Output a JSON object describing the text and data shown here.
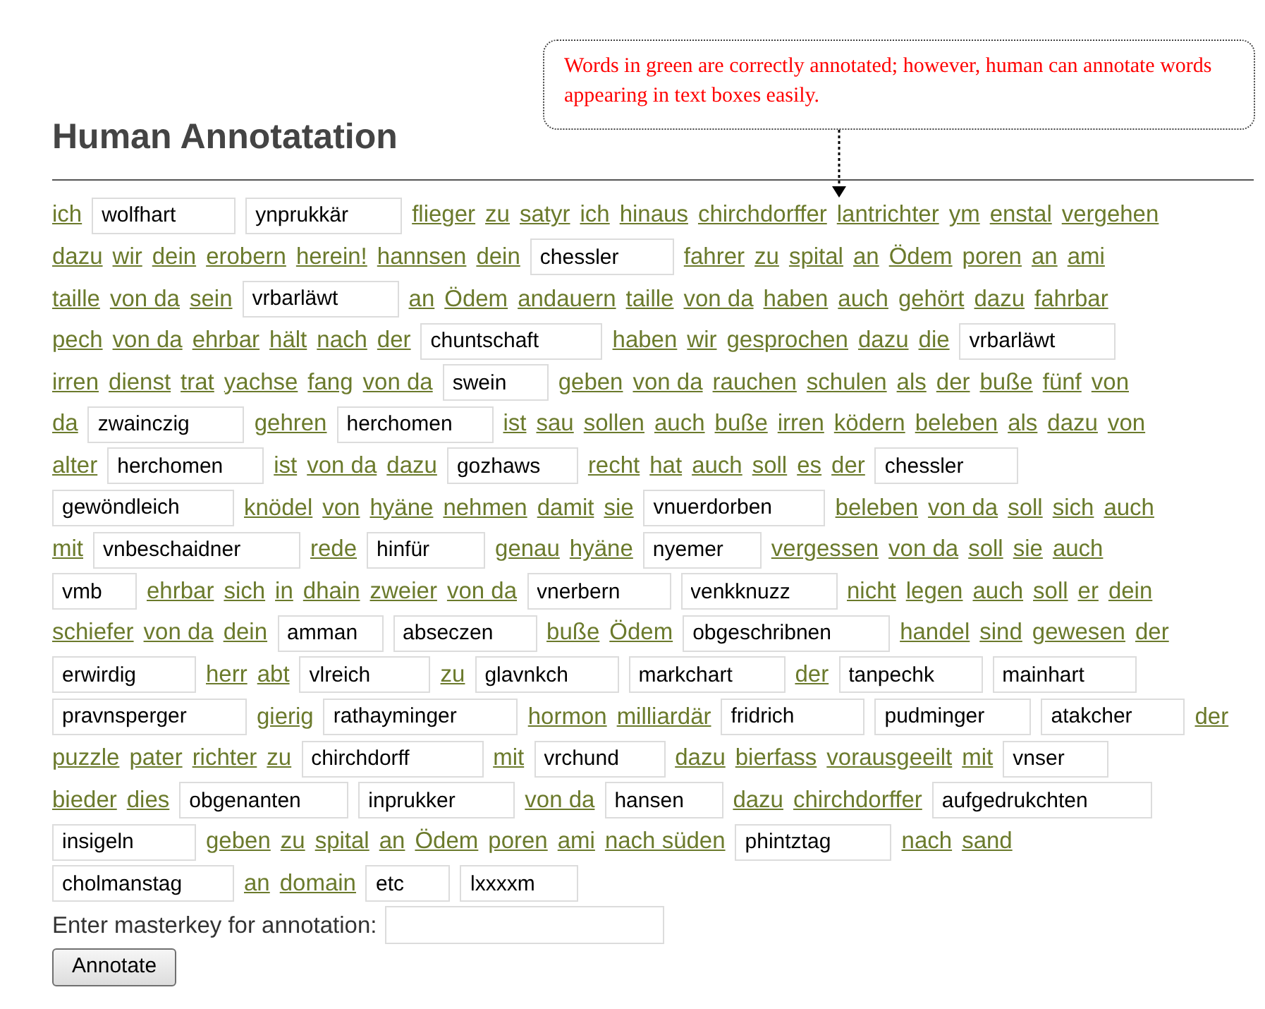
{
  "callout": {
    "text": "Words in green are correctly annotated; however, human can annotate words appearing in text boxes easily."
  },
  "heading": "Human Annotatation",
  "lines": [
    [
      {
        "kind": "word",
        "text": "ich"
      },
      {
        "kind": "field",
        "text": "wolfhart"
      },
      {
        "kind": "field",
        "text": "ynprukkär"
      },
      {
        "kind": "word",
        "text": "flieger"
      },
      {
        "kind": "word",
        "text": "zu"
      },
      {
        "kind": "word",
        "text": "satyr"
      },
      {
        "kind": "word",
        "text": "ich"
      },
      {
        "kind": "word",
        "text": "hinaus"
      },
      {
        "kind": "word",
        "text": "chirchdorffer"
      },
      {
        "kind": "word",
        "text": "lantrichter"
      },
      {
        "kind": "word",
        "text": "ym"
      },
      {
        "kind": "word",
        "text": "enstal"
      },
      {
        "kind": "word",
        "text": "vergehen"
      }
    ],
    [
      {
        "kind": "word",
        "text": "dazu"
      },
      {
        "kind": "word",
        "text": "wir"
      },
      {
        "kind": "word",
        "text": "dein"
      },
      {
        "kind": "word",
        "text": "erobern"
      },
      {
        "kind": "word",
        "text": "herein!"
      },
      {
        "kind": "word",
        "text": "hannsen"
      },
      {
        "kind": "word",
        "text": "dein"
      },
      {
        "kind": "field",
        "text": "chessler"
      },
      {
        "kind": "word",
        "text": "fahrer"
      },
      {
        "kind": "word",
        "text": "zu"
      },
      {
        "kind": "word",
        "text": "spital"
      },
      {
        "kind": "word",
        "text": "an"
      },
      {
        "kind": "word",
        "text": "Ödem"
      },
      {
        "kind": "word",
        "text": "poren"
      },
      {
        "kind": "word",
        "text": "an"
      },
      {
        "kind": "word",
        "text": "ami"
      }
    ],
    [
      {
        "kind": "word",
        "text": "taille"
      },
      {
        "kind": "word",
        "text": "von da"
      },
      {
        "kind": "word",
        "text": "sein"
      },
      {
        "kind": "field",
        "text": "vrbarläwt"
      },
      {
        "kind": "word",
        "text": "an"
      },
      {
        "kind": "word",
        "text": "Ödem"
      },
      {
        "kind": "word",
        "text": "andauern"
      },
      {
        "kind": "word",
        "text": "taille"
      },
      {
        "kind": "word",
        "text": "von da"
      },
      {
        "kind": "word",
        "text": "haben"
      },
      {
        "kind": "word",
        "text": "auch"
      },
      {
        "kind": "word",
        "text": "gehört"
      },
      {
        "kind": "word",
        "text": "dazu"
      },
      {
        "kind": "word",
        "text": "fahrbar"
      }
    ],
    [
      {
        "kind": "word",
        "text": "pech"
      },
      {
        "kind": "word",
        "text": "von da"
      },
      {
        "kind": "word",
        "text": "ehrbar"
      },
      {
        "kind": "word",
        "text": "hält"
      },
      {
        "kind": "word",
        "text": "nach"
      },
      {
        "kind": "word",
        "text": "der"
      },
      {
        "kind": "field",
        "text": "chuntschaft"
      },
      {
        "kind": "word",
        "text": "haben"
      },
      {
        "kind": "word",
        "text": "wir"
      },
      {
        "kind": "word",
        "text": "gesprochen"
      },
      {
        "kind": "word",
        "text": "dazu"
      },
      {
        "kind": "word",
        "text": "die"
      },
      {
        "kind": "field",
        "text": "vrbarläwt"
      }
    ],
    [
      {
        "kind": "word",
        "text": "irren"
      },
      {
        "kind": "word",
        "text": "dienst"
      },
      {
        "kind": "word",
        "text": "trat"
      },
      {
        "kind": "word",
        "text": "yachse"
      },
      {
        "kind": "word",
        "text": "fang"
      },
      {
        "kind": "word",
        "text": "von da"
      },
      {
        "kind": "field",
        "text": "swein"
      },
      {
        "kind": "word",
        "text": "geben"
      },
      {
        "kind": "word",
        "text": "von da"
      },
      {
        "kind": "word",
        "text": "rauchen"
      },
      {
        "kind": "word",
        "text": "schulen"
      },
      {
        "kind": "word",
        "text": "als"
      },
      {
        "kind": "word",
        "text": "der"
      },
      {
        "kind": "word",
        "text": "buße"
      },
      {
        "kind": "word",
        "text": "fünf"
      },
      {
        "kind": "word",
        "text": "von"
      }
    ],
    [
      {
        "kind": "word",
        "text": "da"
      },
      {
        "kind": "field",
        "text": "zwainczig"
      },
      {
        "kind": "word",
        "text": "gehren"
      },
      {
        "kind": "field",
        "text": "herchomen"
      },
      {
        "kind": "word",
        "text": "ist"
      },
      {
        "kind": "word",
        "text": "sau"
      },
      {
        "kind": "word",
        "text": "sollen"
      },
      {
        "kind": "word",
        "text": "auch"
      },
      {
        "kind": "word",
        "text": "buße"
      },
      {
        "kind": "word",
        "text": "irren"
      },
      {
        "kind": "word",
        "text": "ködern"
      },
      {
        "kind": "word",
        "text": "beleben"
      },
      {
        "kind": "word",
        "text": "als"
      },
      {
        "kind": "word",
        "text": "dazu"
      },
      {
        "kind": "word",
        "text": "von"
      }
    ],
    [
      {
        "kind": "word",
        "text": "alter"
      },
      {
        "kind": "field",
        "text": "herchomen"
      },
      {
        "kind": "word",
        "text": "ist"
      },
      {
        "kind": "word",
        "text": "von da"
      },
      {
        "kind": "word",
        "text": "dazu"
      },
      {
        "kind": "field",
        "text": "gozhaws"
      },
      {
        "kind": "word",
        "text": "recht"
      },
      {
        "kind": "word",
        "text": "hat"
      },
      {
        "kind": "word",
        "text": "auch"
      },
      {
        "kind": "word",
        "text": "soll"
      },
      {
        "kind": "word",
        "text": "es"
      },
      {
        "kind": "word",
        "text": "der"
      },
      {
        "kind": "field",
        "text": "chessler"
      }
    ],
    [
      {
        "kind": "field",
        "text": "gewöndleich"
      },
      {
        "kind": "word",
        "text": "knödel"
      },
      {
        "kind": "word",
        "text": "von"
      },
      {
        "kind": "word",
        "text": "hyäne"
      },
      {
        "kind": "word",
        "text": "nehmen"
      },
      {
        "kind": "word",
        "text": "damit"
      },
      {
        "kind": "word",
        "text": "sie"
      },
      {
        "kind": "field",
        "text": "vnuerdorben"
      },
      {
        "kind": "word",
        "text": "beleben"
      },
      {
        "kind": "word",
        "text": "von da"
      },
      {
        "kind": "word",
        "text": "soll"
      },
      {
        "kind": "word",
        "text": "sich"
      },
      {
        "kind": "word",
        "text": "auch"
      }
    ],
    [
      {
        "kind": "word",
        "text": "mit"
      },
      {
        "kind": "field",
        "text": "vnbeschaidner"
      },
      {
        "kind": "word",
        "text": "rede"
      },
      {
        "kind": "field",
        "text": "hinfür"
      },
      {
        "kind": "word",
        "text": "genau"
      },
      {
        "kind": "word",
        "text": "hyäne"
      },
      {
        "kind": "field",
        "text": "nyemer"
      },
      {
        "kind": "word",
        "text": "vergessen"
      },
      {
        "kind": "word",
        "text": "von da"
      },
      {
        "kind": "word",
        "text": "soll"
      },
      {
        "kind": "word",
        "text": "sie"
      },
      {
        "kind": "word",
        "text": "auch"
      }
    ],
    [
      {
        "kind": "field",
        "text": "vmb"
      },
      {
        "kind": "word",
        "text": "ehrbar"
      },
      {
        "kind": "word",
        "text": "sich"
      },
      {
        "kind": "word",
        "text": "in"
      },
      {
        "kind": "word",
        "text": "dhain"
      },
      {
        "kind": "word",
        "text": "zweier"
      },
      {
        "kind": "word",
        "text": "von da"
      },
      {
        "kind": "field",
        "text": "vnerbern"
      },
      {
        "kind": "field",
        "text": "venkknuzz"
      },
      {
        "kind": "word",
        "text": "nicht"
      },
      {
        "kind": "word",
        "text": "legen"
      },
      {
        "kind": "word",
        "text": "auch"
      },
      {
        "kind": "word",
        "text": "soll"
      },
      {
        "kind": "word",
        "text": "er"
      },
      {
        "kind": "word",
        "text": "dein"
      }
    ],
    [
      {
        "kind": "word",
        "text": "schiefer"
      },
      {
        "kind": "word",
        "text": "von da"
      },
      {
        "kind": "word",
        "text": "dein"
      },
      {
        "kind": "field",
        "text": "amman"
      },
      {
        "kind": "field",
        "text": "abseczen"
      },
      {
        "kind": "word",
        "text": "buße"
      },
      {
        "kind": "word",
        "text": "Ödem"
      },
      {
        "kind": "field",
        "text": "obgeschribnen"
      },
      {
        "kind": "word",
        "text": "handel"
      },
      {
        "kind": "word",
        "text": "sind"
      },
      {
        "kind": "word",
        "text": "gewesen"
      },
      {
        "kind": "word",
        "text": "der"
      }
    ],
    [
      {
        "kind": "field",
        "text": "erwirdig"
      },
      {
        "kind": "word",
        "text": "herr"
      },
      {
        "kind": "word",
        "text": "abt"
      },
      {
        "kind": "field",
        "text": "vlreich"
      },
      {
        "kind": "word",
        "text": "zu"
      },
      {
        "kind": "field",
        "text": "glavnkch"
      },
      {
        "kind": "field",
        "text": "markchart"
      },
      {
        "kind": "word",
        "text": "der"
      },
      {
        "kind": "field",
        "text": "tanpechk"
      },
      {
        "kind": "field",
        "text": "mainhart"
      }
    ],
    [
      {
        "kind": "field",
        "text": "pravnsperger"
      },
      {
        "kind": "word",
        "text": "gierig"
      },
      {
        "kind": "field",
        "text": "rathayminger"
      },
      {
        "kind": "word",
        "text": "hormon"
      },
      {
        "kind": "word",
        "text": "milliardär"
      },
      {
        "kind": "field",
        "text": "fridrich"
      },
      {
        "kind": "field",
        "text": "pudminger"
      },
      {
        "kind": "field",
        "text": "atakcher"
      },
      {
        "kind": "word",
        "text": "der"
      }
    ],
    [
      {
        "kind": "word",
        "text": "puzzle"
      },
      {
        "kind": "word",
        "text": "pater"
      },
      {
        "kind": "word",
        "text": "richter"
      },
      {
        "kind": "word",
        "text": "zu"
      },
      {
        "kind": "field",
        "text": "chirchdorff"
      },
      {
        "kind": "word",
        "text": "mit"
      },
      {
        "kind": "field",
        "text": "vrchund"
      },
      {
        "kind": "word",
        "text": "dazu"
      },
      {
        "kind": "word",
        "text": "bierfass"
      },
      {
        "kind": "word",
        "text": "vorausgeeilt"
      },
      {
        "kind": "word",
        "text": "mit"
      },
      {
        "kind": "field",
        "text": "vnser"
      }
    ],
    [
      {
        "kind": "word",
        "text": "bieder"
      },
      {
        "kind": "word",
        "text": "dies"
      },
      {
        "kind": "field",
        "text": "obgenanten"
      },
      {
        "kind": "field",
        "text": "inprukker"
      },
      {
        "kind": "word",
        "text": "von da"
      },
      {
        "kind": "field",
        "text": "hansen"
      },
      {
        "kind": "word",
        "text": "dazu"
      },
      {
        "kind": "word",
        "text": "chirchdorffer"
      },
      {
        "kind": "field",
        "text": "aufgedrukchten"
      }
    ],
    [
      {
        "kind": "field",
        "text": "insigeln"
      },
      {
        "kind": "word",
        "text": "geben"
      },
      {
        "kind": "word",
        "text": "zu"
      },
      {
        "kind": "word",
        "text": "spital"
      },
      {
        "kind": "word",
        "text": "an"
      },
      {
        "kind": "word",
        "text": "Ödem"
      },
      {
        "kind": "word",
        "text": "poren"
      },
      {
        "kind": "word",
        "text": "ami"
      },
      {
        "kind": "word",
        "text": "nach süden"
      },
      {
        "kind": "field",
        "text": "phintztag"
      },
      {
        "kind": "word",
        "text": "nach"
      },
      {
        "kind": "word",
        "text": "sand"
      }
    ],
    [
      {
        "kind": "field",
        "text": "cholmanstag"
      },
      {
        "kind": "word",
        "text": "an"
      },
      {
        "kind": "word",
        "text": "domain"
      },
      {
        "kind": "field",
        "text": "etc"
      },
      {
        "kind": "field",
        "text": "lxxxxm"
      }
    ]
  ],
  "masterkey": {
    "label": "Enter masterkey for annotation:"
  },
  "submit": "Annotate"
}
